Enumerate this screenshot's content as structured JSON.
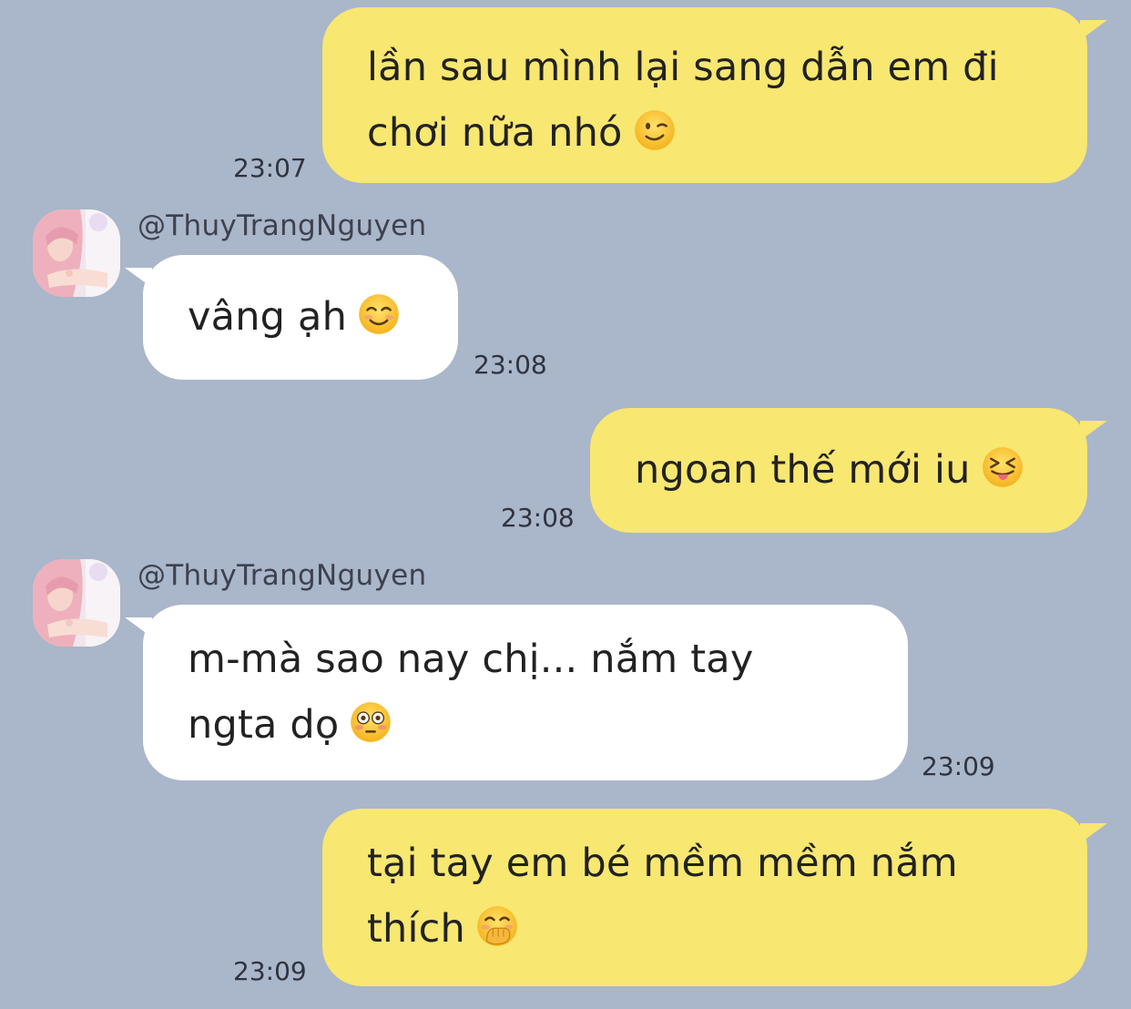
{
  "chat": {
    "messages": [
      {
        "direction": "outgoing",
        "lines": [
          "lần sau mình lại sang dẫn em đi",
          "chơi nữa nhó"
        ],
        "emoji": "winking-face-icon",
        "time": "23:07"
      },
      {
        "direction": "incoming",
        "sender": "@ThuyTrangNguyen",
        "lines": [
          "vâng ạh"
        ],
        "emoji": "smiling-face-icon",
        "time": "23:08"
      },
      {
        "direction": "outgoing",
        "lines": [
          "ngoan thế mới iu"
        ],
        "emoji": "squinting-tongue-face-icon",
        "time": "23:08"
      },
      {
        "direction": "incoming",
        "sender": "@ThuyTrangNguyen",
        "lines": [
          "m-mà sao nay chị... nắm tay",
          "ngta dọ"
        ],
        "emoji": "flushed-face-icon",
        "time": "23:09"
      },
      {
        "direction": "outgoing",
        "lines": [
          "tại tay em bé mềm mềm nắm",
          "thích"
        ],
        "emoji": "hand-over-mouth-face-icon",
        "time": "23:09"
      }
    ]
  },
  "colors": {
    "background": "#aab6c9",
    "outgoing_bubble": "#f8e771",
    "incoming_bubble": "#ffffff",
    "text": "#222222",
    "timestamp": "#2f3340"
  }
}
